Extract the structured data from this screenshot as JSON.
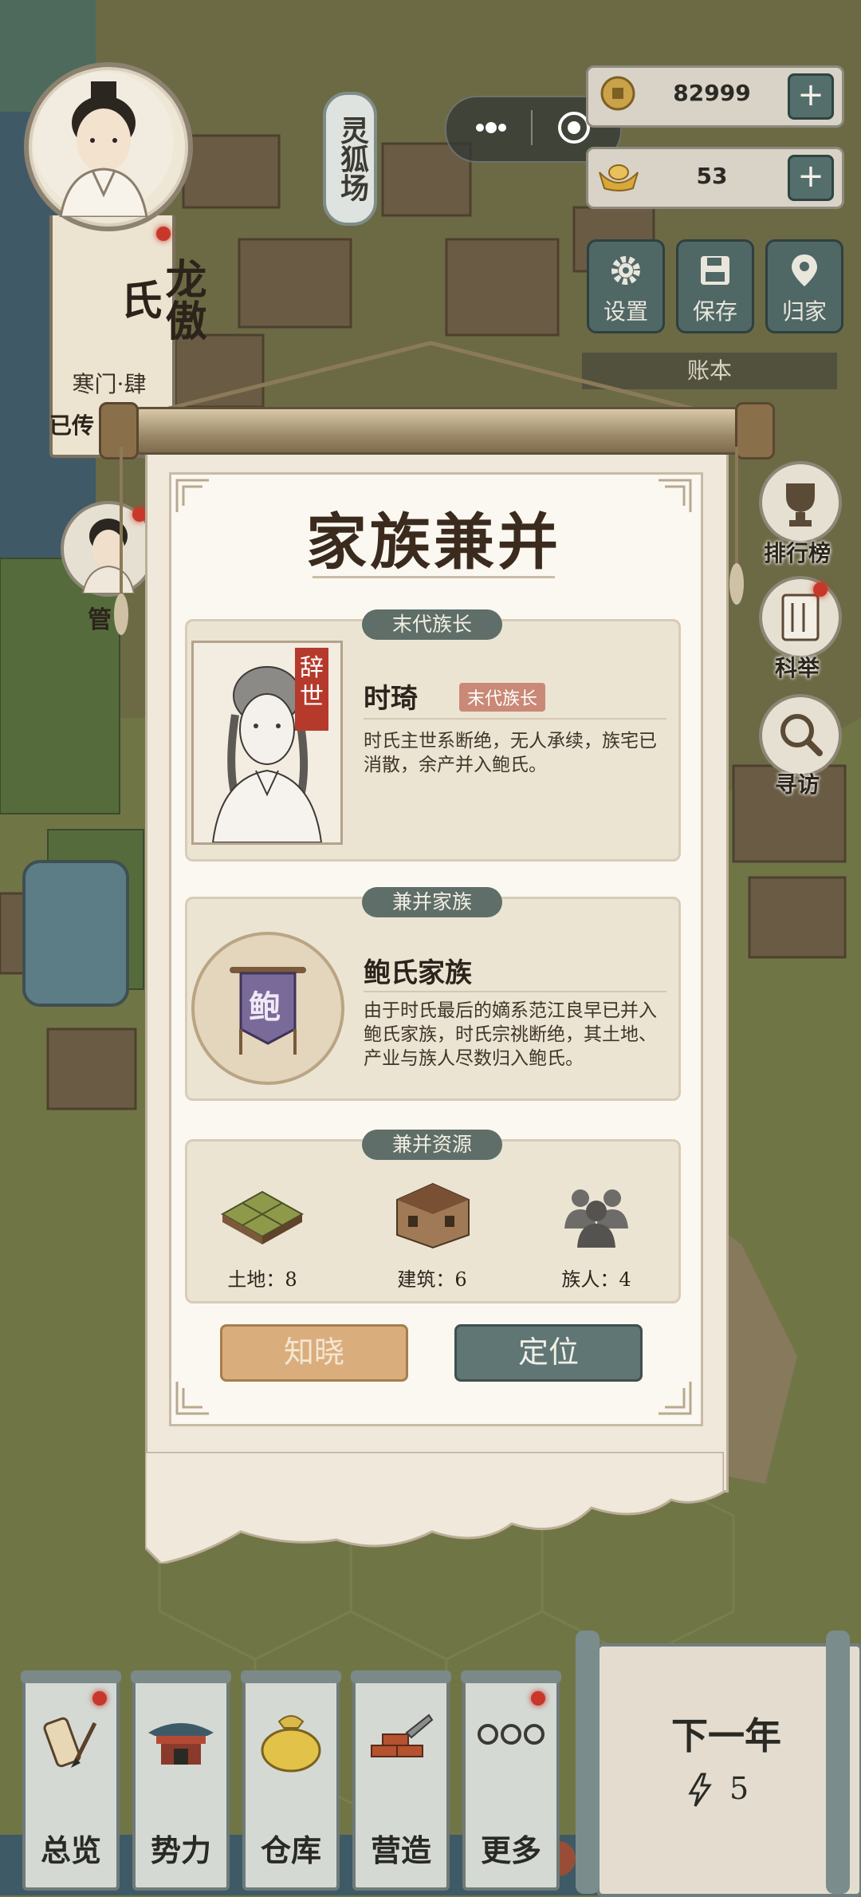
{
  "player": {
    "name": "龙傲氏",
    "rank": "寒门·肆",
    "status": "已传"
  },
  "place_label": "灵狐场",
  "currency": {
    "coins": "82999",
    "ingots": "53"
  },
  "toolbar": {
    "settings": "设置",
    "save": "保存",
    "home": "归家"
  },
  "ledger_label": "账本",
  "side_buttons": {
    "ranking": "排行榜",
    "exam": "科举",
    "visit": "寻访"
  },
  "steward_label": "管",
  "modal": {
    "title": "家族兼并",
    "last_leader": {
      "section_title": "末代族长",
      "deceased_tag": "辞世",
      "name": "时琦",
      "badge": "末代族长",
      "description": "时氏主世系断绝，无人承续，族宅已消散，余产并入鲍氏。"
    },
    "merging_family": {
      "section_title": "兼并家族",
      "emblem_char": "鲍",
      "name": "鲍氏家族",
      "description": "由于时氏最后的嫡系范江良早已并入鲍氏家族，时氏宗祧断绝，其土地、产业与族人尽数归入鲍氏。"
    },
    "resources": {
      "section_title": "兼并资源",
      "items": [
        {
          "label": "土地：8",
          "icon": "land-icon"
        },
        {
          "label": "建筑：6",
          "icon": "building-icon"
        },
        {
          "label": "族人：4",
          "icon": "people-icon"
        }
      ]
    },
    "buttons": {
      "acknowledge": "知晓",
      "locate": "定位"
    }
  },
  "bottom_nav": [
    {
      "label": "总览",
      "icon": "scroll-brush-icon"
    },
    {
      "label": "势力",
      "icon": "pavilion-icon"
    },
    {
      "label": "仓库",
      "icon": "sack-icon"
    },
    {
      "label": "营造",
      "icon": "bricks-trowel-icon"
    },
    {
      "label": "更多",
      "icon": "more-dots-icon"
    }
  ],
  "next_year": {
    "label": "下一年",
    "energy": "5"
  },
  "colors": {
    "accent_teal": "#5f7674",
    "accent_gold": "#d9ae7c",
    "alert_red": "#c8382a"
  }
}
